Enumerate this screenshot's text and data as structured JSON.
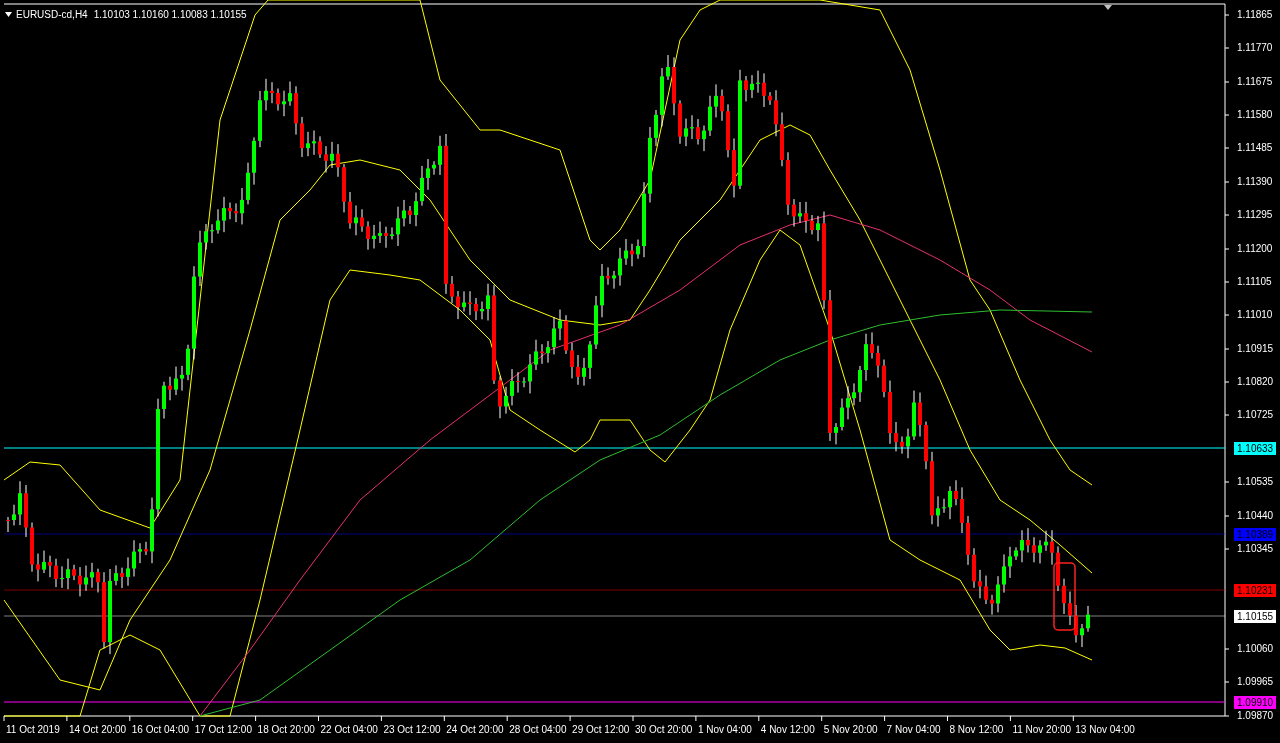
{
  "header": {
    "symbol": "EURUSD-cd,H4",
    "prices": "1.10103 1.10160 1.10083 1.10155"
  },
  "price_axis": {
    "ticks": [
      "1.11865",
      "1.11770",
      "1.11675",
      "1.11580",
      "1.11485",
      "1.11390",
      "1.11295",
      "1.11200",
      "1.11105",
      "1.11010",
      "1.10915",
      "1.10820",
      "1.10725",
      "1.10535",
      "1.10440",
      "1.10345",
      "1.10060",
      "1.09965",
      "1.09870"
    ],
    "levels": [
      {
        "price": "1.10633",
        "color": "#00ffff"
      },
      {
        "price": "1.10389",
        "color": "#0000ff"
      },
      {
        "price": "1.10231",
        "color": "#ff0000"
      },
      {
        "price": "1.10155",
        "color": "#ffffff"
      },
      {
        "price": "1.09910",
        "color": "#ff00ff"
      }
    ]
  },
  "time_axis": {
    "labels": [
      "11 Oct 2019",
      "14 Oct 20:00",
      "16 Oct 04:00",
      "17 Oct 12:00",
      "18 Oct 20:00",
      "22 Oct 04:00",
      "23 Oct 12:00",
      "24 Oct 20:00",
      "28 Oct 04:00",
      "29 Oct 12:00",
      "30 Oct 20:00",
      "1 Nov 04:00",
      "4 Nov 12:00",
      "5 Nov 20:00",
      "7 Nov 04:00",
      "8 Nov 12:00",
      "11 Nov 20:00",
      "13 Nov 04:00"
    ]
  }
}
